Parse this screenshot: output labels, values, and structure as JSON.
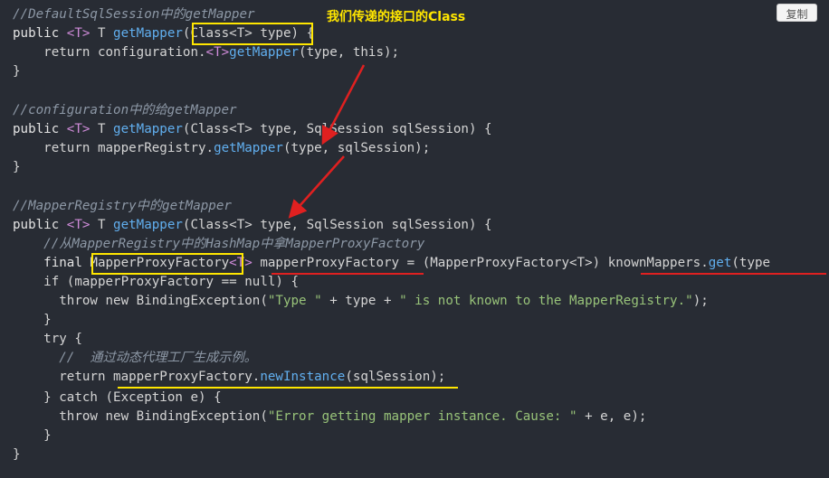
{
  "toolbar": {
    "copy_label": "复制"
  },
  "annotation": {
    "label": "我们传递的接口的Class"
  },
  "code": {
    "l1": "//DefaultSqlSession中的getMapper",
    "l2": {
      "public": "public ",
      "tp": "<T>",
      "sp": " T ",
      "fn": "getMapper",
      "rest": "(Class<T> type) {"
    },
    "l3": {
      "indent": "    return configuration.",
      "tp": "<T>",
      "fn": "getMapper",
      "rest": "(type, this);"
    },
    "l4": "}",
    "l6": "//configuration中的给getMapper",
    "l7": {
      "public": "public ",
      "tp": "<T>",
      "sp": " T ",
      "fn": "getMapper",
      "rest": "(Class<T> type, SqlSession sqlSession) {"
    },
    "l8": {
      "indent": "    return mapperRegistry.",
      "fn": "getMapper",
      "rest": "(type, sqlSession);"
    },
    "l9": "}",
    "l11": "//MapperRegistry中的getMapper",
    "l12": {
      "public": "public ",
      "tp": "<T>",
      "sp": " T ",
      "fn": "getMapper",
      "rest": "(Class<T> type, SqlSession sqlSession) {"
    },
    "l13": "    //从MapperRegistry中的HashMap中拿MapperProxyFactory",
    "l14": {
      "kw": "    final ",
      "cls": "MapperProxyFactory",
      "tp": "<T>",
      "rest": " mapperProxyFactory = (MapperProxyFactory<T>) knownMappers.",
      "fn": "get",
      "tail": "(type"
    },
    "l15": "    if (mapperProxyFactory == null) {",
    "l16": {
      "pre": "      throw new BindingException(",
      "str": "\"Type \"",
      "mid": " + type + ",
      "str2": "\" is not known to the MapperRegistry.\"",
      "post": ");"
    },
    "l17": "    }",
    "l18": "    try {",
    "l19": "      //  通过动态代理工厂生成示例。",
    "l20": {
      "pre": "      return mapperProxyFactory.",
      "fn": "newInstance",
      "post": "(sqlSession);"
    },
    "l21": "    } catch (Exception e) {",
    "l22": {
      "pre": "      throw new BindingException(",
      "str": "\"Error getting mapper instance. Cause: \"",
      "post": " + e, e);"
    },
    "l23": "    }",
    "l24": "}"
  },
  "colors": {
    "background": "#282c34",
    "highlight": "#ffe600",
    "arrow": "#e02020"
  }
}
